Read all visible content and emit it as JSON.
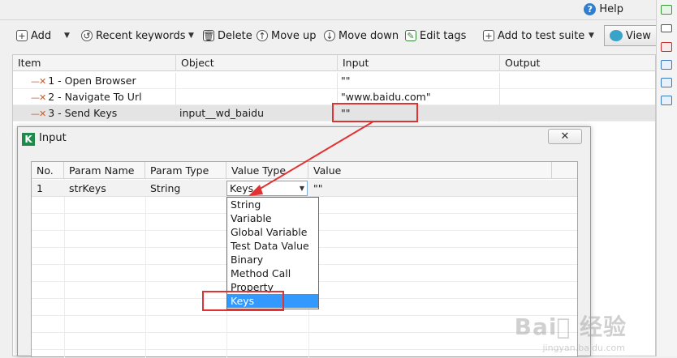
{
  "header": {
    "help_label": "Help"
  },
  "toolbar": {
    "add": "Add",
    "recent_keywords": "Recent keywords",
    "delete": "Delete",
    "move_up": "Move up",
    "move_down": "Move down",
    "edit_tags": "Edit tags",
    "add_to_test_suite": "Add to test suite",
    "view": "View"
  },
  "grid": {
    "columns": [
      "Item",
      "Object",
      "Input",
      "Output"
    ],
    "rows": [
      {
        "item": "1 - Open Browser",
        "object": "",
        "input": "\"\"",
        "output": ""
      },
      {
        "item": "2 - Navigate To Url",
        "object": "",
        "input": "\"www.baidu.com\"",
        "output": ""
      },
      {
        "item": "3 - Send Keys",
        "object": "input__wd_baidu",
        "input": "\"\"",
        "output": ""
      }
    ]
  },
  "dialog": {
    "title": "Input",
    "columns": [
      "No.",
      "Param Name",
      "Param Type",
      "Value Type",
      "Value"
    ],
    "rows": [
      {
        "no": "1",
        "param_name": "strKeys",
        "param_type": "String",
        "value_type": "Keys",
        "value": "\"\""
      }
    ],
    "value_type_options": [
      "String",
      "Variable",
      "Global Variable",
      "Test Data Value",
      "Binary",
      "Method Call",
      "Property",
      "Keys"
    ],
    "selected_option": "Keys"
  },
  "watermark": {
    "brand": "Bai⃝ 经验",
    "url": "jingyan.baidu.com"
  },
  "colors": {
    "annotation": "#e13333",
    "selection": "#3399ff",
    "error_mark": "#d2581f"
  }
}
